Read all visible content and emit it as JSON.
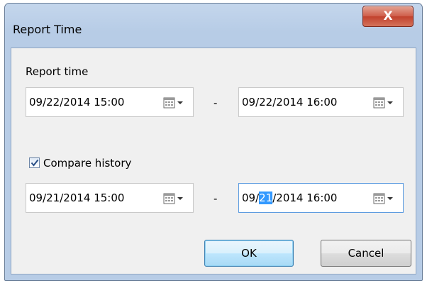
{
  "window": {
    "title": "Report Time",
    "close_glyph": "X"
  },
  "report_time": {
    "label": "Report time",
    "start": "09/22/2014 15:00",
    "end": "09/22/2014 16:00",
    "separator": "-"
  },
  "compare_history": {
    "label": "Compare history",
    "checked": true,
    "start": "09/21/2014 15:00",
    "end": {
      "before_selection": "09/",
      "selected": "21",
      "after_selection": "/2014 16:00"
    },
    "separator": "-"
  },
  "buttons": {
    "ok": "OK",
    "cancel": "Cancel"
  },
  "icons": {
    "picker": "calendar-dropdown-icon",
    "checkmark": "checkmark-icon",
    "close": "close-icon"
  },
  "colors": {
    "title_bar": "#b7cce6",
    "close_button": "#c94a35",
    "selection": "#3399ff",
    "dialog_body": "#f0f0f0"
  }
}
